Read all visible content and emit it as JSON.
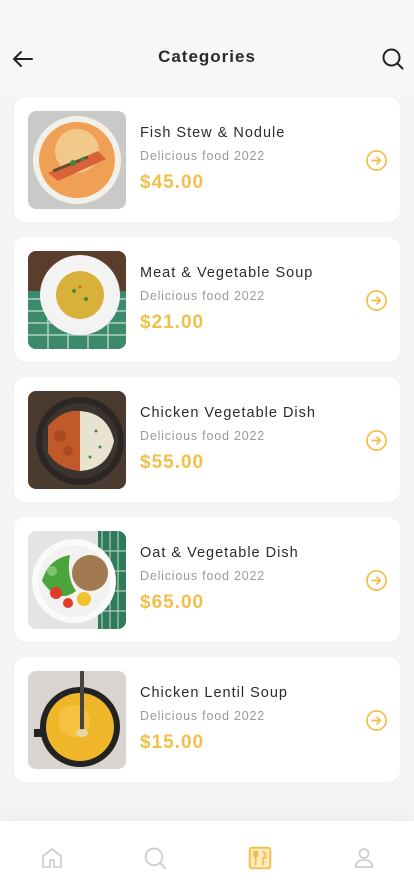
{
  "header": {
    "title": "Categories",
    "back_icon": "arrow-left-icon",
    "search_icon": "search-icon"
  },
  "colors": {
    "accent": "#F0C04A",
    "text": "#2B2B2B",
    "muted": "#9A9A9A",
    "background": "#F5F5F5"
  },
  "items": [
    {
      "name": "Fish Stew & Nodule",
      "subtitle": "Delicious food 2022",
      "price": "$45.00"
    },
    {
      "name": "Meat & Vegetable Soup",
      "subtitle": "Delicious food 2022",
      "price": "$21.00"
    },
    {
      "name": "Chicken Vegetable Dish",
      "subtitle": "Delicious food 2022",
      "price": "$55.00"
    },
    {
      "name": "Oat & Vegetable Dish",
      "subtitle": "Delicious food 2022",
      "price": "$65.00"
    },
    {
      "name": "Chicken Lentil Soup",
      "subtitle": "Delicious food 2022",
      "price": "$15.00"
    }
  ],
  "tabbar": {
    "tabs": [
      {
        "icon": "home-icon",
        "active": false
      },
      {
        "icon": "search-icon",
        "active": false
      },
      {
        "icon": "menu-icon",
        "active": true
      },
      {
        "icon": "user-icon",
        "active": false
      }
    ]
  }
}
